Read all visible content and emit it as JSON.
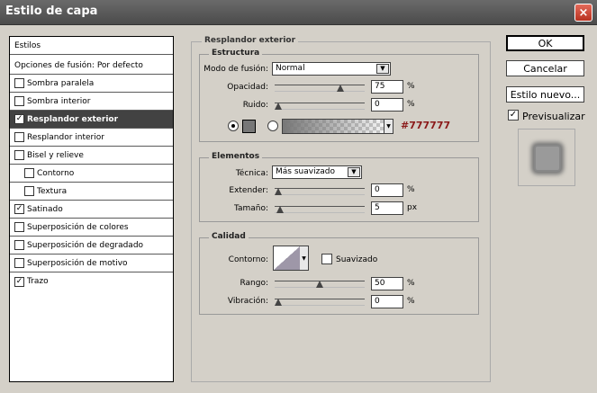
{
  "window": {
    "title": "Estilo de capa"
  },
  "styles_list": {
    "header": "Estilos",
    "blend_default": "Opciones de fusión: Por defecto",
    "items": [
      {
        "label": "Sombra paralela",
        "checked": false,
        "check": ""
      },
      {
        "label": "Sombra interior",
        "checked": false,
        "check": ""
      },
      {
        "label": "Resplandor exterior",
        "checked": true,
        "check": "✓"
      },
      {
        "label": "Resplandor interior",
        "checked": false,
        "check": ""
      },
      {
        "label": "Bisel y relieve",
        "checked": false,
        "check": ""
      },
      {
        "label": "Contorno",
        "checked": false,
        "check": ""
      },
      {
        "label": "Textura",
        "checked": false,
        "check": ""
      },
      {
        "label": "Satinado",
        "checked": true,
        "check": "✓"
      },
      {
        "label": "Superposición de colores",
        "checked": false,
        "check": ""
      },
      {
        "label": "Superposición de degradado",
        "checked": false,
        "check": ""
      },
      {
        "label": "Superposición de motivo",
        "checked": false,
        "check": ""
      },
      {
        "label": "Trazo",
        "checked": true,
        "check": "✓"
      }
    ]
  },
  "main": {
    "title": "Resplandor exterior",
    "structure": {
      "title": "Estructura",
      "blend_mode_label": "Modo de fusión:",
      "blend_mode_value": "Normal",
      "opacity_label": "Opacidad:",
      "opacity_value": "75",
      "opacity_level": 0.75,
      "noise_label": "Ruido:",
      "noise_value": "0",
      "noise_level": 0,
      "percent": "%",
      "color_hex": "#777777"
    },
    "elements": {
      "title": "Elementos",
      "technique_label": "Técnica:",
      "technique_value": "Más suavizado",
      "spread_label": "Extender:",
      "spread_value": "0",
      "spread_level": 0,
      "size_label": "Tamaño:",
      "size_value": "5",
      "size_level": 0.02,
      "percent": "%",
      "px": "px"
    },
    "quality": {
      "title": "Calidad",
      "contour_label": "Contorno:",
      "antialias_label": "Suavizado",
      "range_label": "Rango:",
      "range_value": "50",
      "range_level": 0.5,
      "jitter_label": "Vibración:",
      "jitter_value": "0",
      "jitter_level": 0,
      "percent": "%"
    }
  },
  "buttons": {
    "ok": "OK",
    "cancel": "Cancelar",
    "new_style": "Estilo nuevo...",
    "preview_label": "Previsualizar",
    "preview_check": "✓"
  },
  "icons": {
    "close": "×",
    "dropdown": "▼"
  },
  "colors": {
    "glow": "#777777",
    "hex_text": "#8b1a1a"
  }
}
